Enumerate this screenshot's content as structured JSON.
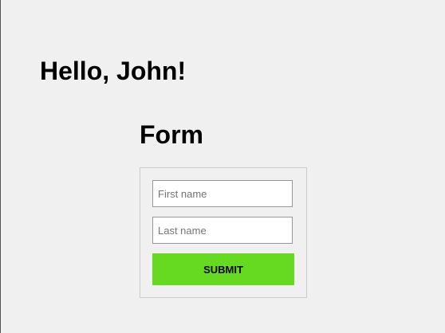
{
  "greeting": {
    "text": "Hello, John!"
  },
  "form": {
    "heading": "Form",
    "first_name": {
      "value": "",
      "placeholder": "First name"
    },
    "last_name": {
      "value": "",
      "placeholder": "Last name"
    },
    "submit_label": "SUBMIT",
    "submit_color": "#66d921"
  }
}
